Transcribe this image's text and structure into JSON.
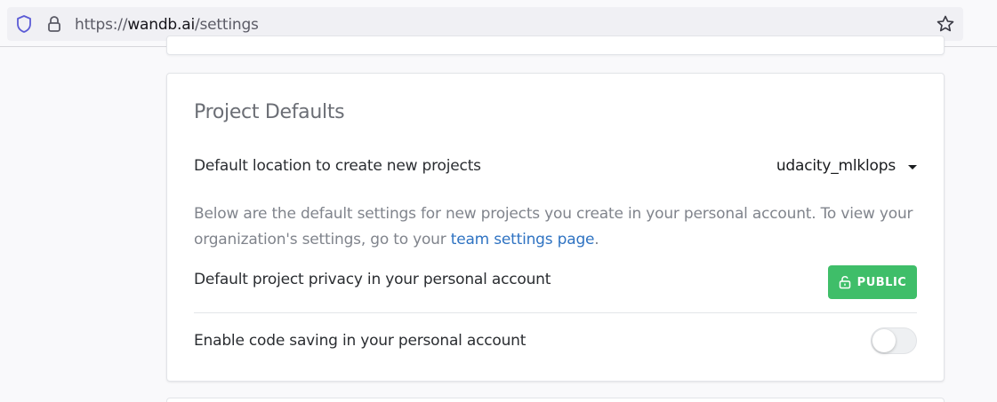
{
  "browser": {
    "url_prefix": "https://",
    "url_host": "wandb.ai",
    "url_path": "/settings",
    "icons": [
      "shield-icon",
      "lock-icon",
      "star-icon"
    ]
  },
  "project_defaults": {
    "title": "Project Defaults",
    "location_label": "Default location to create new projects",
    "location_value": "udacity_mlklops",
    "description_text": "Below are the default settings for new projects you create in your personal account. To view your organization's settings, go to your ",
    "description_link": "team settings page",
    "description_end": ".",
    "privacy_label": "Default project privacy in your personal account",
    "privacy_button": "PUBLIC",
    "privacy_color": "#3fbe69",
    "code_saving_label": "Enable code saving in your personal account",
    "code_saving_enabled": false
  }
}
